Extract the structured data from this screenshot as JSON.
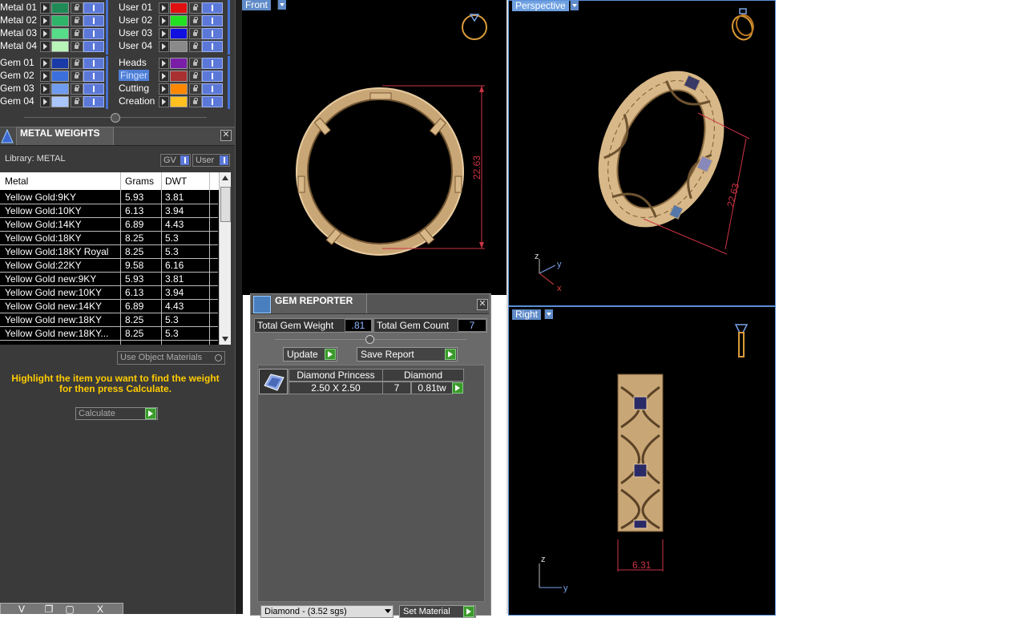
{
  "layers": {
    "left": [
      {
        "name": "Metal 01",
        "color": "#1f8a55"
      },
      {
        "name": "Metal 02",
        "color": "#2fb56a"
      },
      {
        "name": "Metal 03",
        "color": "#55dd88"
      },
      {
        "name": "Metal 04",
        "color": "#b8f5b8"
      },
      {
        "name": "Gem 01",
        "color": "#1a3aa8"
      },
      {
        "name": "Gem 02",
        "color": "#3a6fdc"
      },
      {
        "name": "Gem 03",
        "color": "#6f9cf0"
      },
      {
        "name": "Gem 04",
        "color": "#a9c6fb"
      }
    ],
    "right": [
      {
        "name": "User 01",
        "color": "#e01010"
      },
      {
        "name": "User 02",
        "color": "#22e022"
      },
      {
        "name": "User 03",
        "color": "#1010e0"
      },
      {
        "name": "User 04",
        "color": "#8a8a8a"
      },
      {
        "name": "Heads",
        "color": "#7a1ea8"
      },
      {
        "name": "Finger",
        "color": "#a83030",
        "selected": true
      },
      {
        "name": "Cutting",
        "color": "#ff8800"
      },
      {
        "name": "Creation",
        "color": "#ffc020"
      }
    ]
  },
  "metal_weights": {
    "title": "METAL WEIGHTS",
    "library_label": "Library: METAL",
    "toggle_gv": "GV",
    "toggle_user": "User",
    "columns": [
      "Metal",
      "Grams",
      "DWT"
    ],
    "rows": [
      [
        "Yellow Gold:9KY",
        "5.93",
        "3.81"
      ],
      [
        "Yellow Gold:10KY",
        "6.13",
        "3.94"
      ],
      [
        "Yellow Gold:14KY",
        "6.89",
        "4.43"
      ],
      [
        "Yellow Gold:18KY",
        "8.25",
        "5.3"
      ],
      [
        "Yellow Gold:18KY Royal",
        "8.25",
        "5.3"
      ],
      [
        "Yellow Gold:22KY",
        "9.58",
        "6.16"
      ],
      [
        "Yellow Gold new:9KY",
        "5.93",
        "3.81"
      ],
      [
        "Yellow Gold new:10KY",
        "6.13",
        "3.94"
      ],
      [
        "Yellow Gold new:14KY",
        "6.89",
        "4.43"
      ],
      [
        "Yellow Gold new:18KY",
        "8.25",
        "5.3"
      ],
      [
        "Yellow Gold new:18KY...",
        "8.25",
        "5.3"
      ]
    ],
    "use_object_materials": "Use Object Materials",
    "hint": "Highlight the item you want to find the weight for then press Calculate.",
    "calculate": "Calculate",
    "bottom_tabs": [
      "V",
      "",
      "",
      "X"
    ]
  },
  "viewports": {
    "front": {
      "label": "Front",
      "dimension": "22.63"
    },
    "perspective": {
      "label": "Perspective",
      "dimension": "22.63"
    },
    "right": {
      "label": "Right",
      "dimension": "6.31"
    }
  },
  "axes": {
    "z": "z",
    "y": "y",
    "x": "x"
  },
  "gem_reporter": {
    "title": "GEM REPORTER",
    "total_weight_label": "Total Gem Weight",
    "total_weight_value": ".81",
    "total_count_label": "Total Gem Count",
    "total_count_value": "7",
    "update_label": "Update",
    "save_report_label": "Save Report",
    "item": {
      "cut": "Diamond Princess",
      "material": "Diamond",
      "size": "2.50 X 2.50",
      "count": "7",
      "weight": "0.81tw"
    },
    "material_dropdown": "Diamond - (3.52 sgs)",
    "set_material": "Set Material"
  }
}
